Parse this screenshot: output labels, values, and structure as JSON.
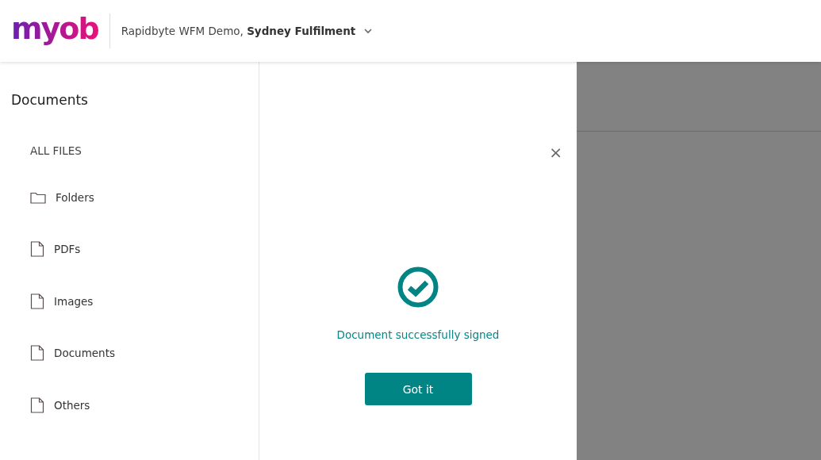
{
  "header": {
    "logo": "myob",
    "business": "Rapidbyte WFM Demo, ",
    "location": "Sydney Fulfilment"
  },
  "sidebar": {
    "title": "Documents",
    "section": "ALL FILES",
    "items": [
      {
        "kind": "folder",
        "label": "Folders"
      },
      {
        "kind": "file",
        "label": "PDFs"
      },
      {
        "kind": "file",
        "label": "Images"
      },
      {
        "kind": "file",
        "label": "Documents"
      },
      {
        "kind": "file",
        "label": "Others"
      }
    ]
  },
  "dialog": {
    "close": "×",
    "message": "Document successfully signed",
    "button": "Got it"
  }
}
